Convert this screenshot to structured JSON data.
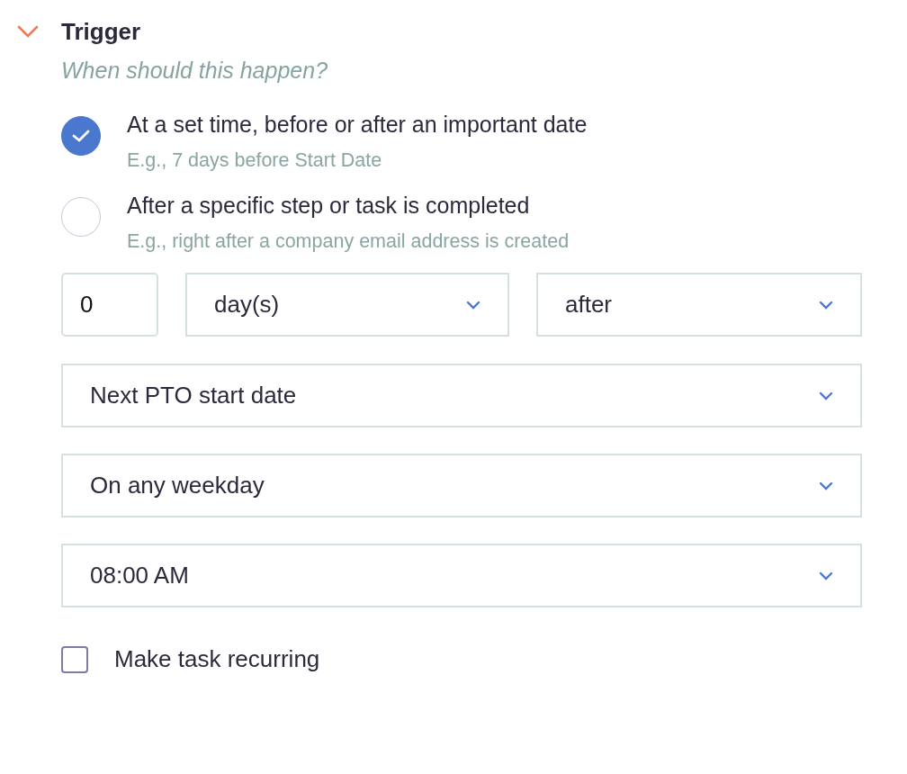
{
  "section": {
    "title": "Trigger",
    "expanded": true,
    "subtitle": "When should this happen?"
  },
  "options": [
    {
      "label": "At a set time, before or after an important date",
      "hint": "E.g., 7 days before Start Date",
      "selected": true
    },
    {
      "label": "After a specific step or task is completed",
      "hint": "E.g., right after a company email address is created",
      "selected": false
    }
  ],
  "offset": {
    "value": "0"
  },
  "unit": {
    "value": "day(s)"
  },
  "direction": {
    "value": "after"
  },
  "selects": [
    {
      "value": "Next PTO start date"
    },
    {
      "value": "On any weekday"
    },
    {
      "value": "08:00 AM"
    }
  ],
  "recurring": {
    "label": "Make task recurring",
    "checked": false
  }
}
